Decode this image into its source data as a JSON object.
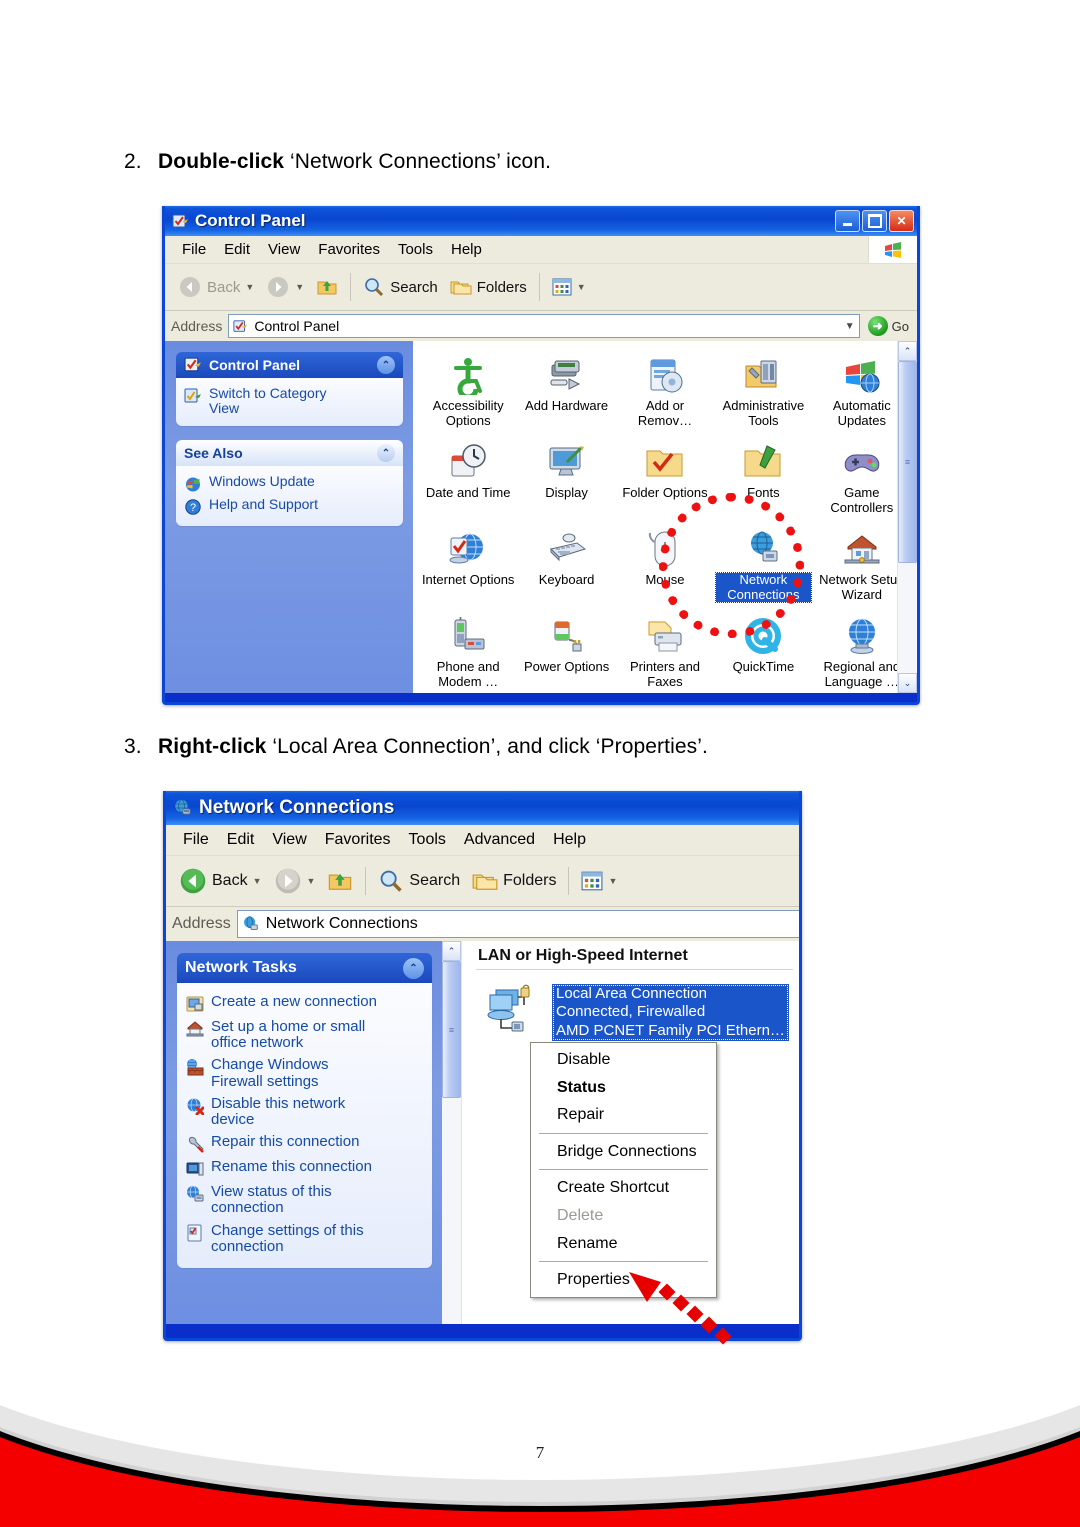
{
  "document": {
    "page_number": "7",
    "steps": [
      {
        "number": "2.",
        "text_plain": "Double-click ‘Network Connections’ icon.",
        "bold_part": "Double-click",
        "rest": " ‘Network Connections’ icon."
      },
      {
        "number": "3.",
        "text_plain": "Right-click ‘Local Area Connection’, and click ‘Properties’.",
        "bold_part": "Right-click",
        "rest": " ‘Local Area Connection’, and click ‘Properties’."
      }
    ]
  },
  "control_panel_window": {
    "title": "Control Panel",
    "title_icon": "control-panel-icon",
    "window_buttons": {
      "minimize": "_",
      "maximize": "□",
      "close": "✕"
    },
    "menu": [
      "File",
      "Edit",
      "View",
      "Favorites",
      "Tools",
      "Help"
    ],
    "toolbar": {
      "back_label": "Back",
      "forward_label": "",
      "up_label": "",
      "search_label": "Search",
      "folders_label": "Folders",
      "views_label": ""
    },
    "address": {
      "label": "Address",
      "value": "Control Panel",
      "go_label": "Go"
    },
    "sidebar": {
      "panels": [
        {
          "title": "Control Panel",
          "style": "blue",
          "icon": "control-panel-icon",
          "items": [
            {
              "label": "Switch to Category View",
              "icon": "category-view-icon"
            }
          ]
        },
        {
          "title": "See Also",
          "style": "pale",
          "icon": "",
          "items": [
            {
              "label": "Windows Update",
              "icon": "windows-update-icon"
            },
            {
              "label": "Help and Support",
              "icon": "help-support-icon"
            }
          ]
        }
      ]
    },
    "icons": [
      {
        "label": "Accessibility Options",
        "icon": "accessibility-icon",
        "selected": false
      },
      {
        "label": "Add Hardware",
        "icon": "add-hardware-icon",
        "selected": false
      },
      {
        "label": "Add or Remov…",
        "icon": "add-remove-programs-icon",
        "selected": false
      },
      {
        "label": "Administrative Tools",
        "icon": "administrative-tools-icon",
        "selected": false
      },
      {
        "label": "Automatic Updates",
        "icon": "automatic-updates-icon",
        "selected": false
      },
      {
        "label": "Date and Time",
        "icon": "date-time-icon",
        "selected": false
      },
      {
        "label": "Display",
        "icon": "display-icon",
        "selected": false
      },
      {
        "label": "Folder Options",
        "icon": "folder-options-icon",
        "selected": false
      },
      {
        "label": "Fonts",
        "icon": "fonts-icon",
        "selected": false
      },
      {
        "label": "Game Controllers",
        "icon": "game-controllers-icon",
        "selected": false
      },
      {
        "label": "Internet Options",
        "icon": "internet-options-icon",
        "selected": false
      },
      {
        "label": "Keyboard",
        "icon": "keyboard-icon",
        "selected": false
      },
      {
        "label": "Mouse",
        "icon": "mouse-icon",
        "selected": false
      },
      {
        "label": "Network Connections",
        "icon": "network-connections-icon",
        "selected": true
      },
      {
        "label": "Network Setup Wizard",
        "icon": "network-setup-wizard-icon",
        "selected": false
      },
      {
        "label": "Phone and Modem …",
        "icon": "phone-modem-icon",
        "selected": false
      },
      {
        "label": "Power Options",
        "icon": "power-options-icon",
        "selected": false
      },
      {
        "label": "Printers and Faxes",
        "icon": "printers-faxes-icon",
        "selected": false
      },
      {
        "label": "QuickTime",
        "icon": "quicktime-icon",
        "selected": false
      },
      {
        "label": "Regional and Language …",
        "icon": "regional-language-icon",
        "selected": false
      }
    ],
    "highlight": {
      "shape": "dotted-circle",
      "color": "#ee1111",
      "target": "Network Connections"
    }
  },
  "network_connections_window": {
    "title": "Network Connections",
    "title_icon": "network-connections-icon",
    "menu": [
      "File",
      "Edit",
      "View",
      "Favorites",
      "Tools",
      "Advanced",
      "Help"
    ],
    "toolbar": {
      "back_label": "Back",
      "search_label": "Search",
      "folders_label": "Folders"
    },
    "address": {
      "label": "Address",
      "value": "Network Connections"
    },
    "sidebar": {
      "panels": [
        {
          "title": "Network Tasks",
          "style": "blue",
          "items": [
            {
              "label": "Create a new connection",
              "icon": "new-connection-icon"
            },
            {
              "label": "Set up a home or small office network",
              "icon": "home-network-icon"
            },
            {
              "label": "Change Windows Firewall settings",
              "icon": "firewall-icon"
            },
            {
              "label": "Disable this network device",
              "icon": "disable-device-icon"
            },
            {
              "label": "Repair this connection",
              "icon": "repair-icon"
            },
            {
              "label": "Rename this connection",
              "icon": "rename-icon"
            },
            {
              "label": "View status of this connection",
              "icon": "view-status-icon"
            },
            {
              "label": "Change settings of this connection",
              "icon": "change-settings-icon"
            }
          ]
        }
      ]
    },
    "group_header": "LAN or High-Speed Internet",
    "connection": {
      "icon": "lan-connection-icon",
      "name": "Local Area Connection",
      "status": "Connected, Firewalled",
      "adapter": "AMD PCNET Family PCI Ethern…",
      "selected": true
    },
    "context_menu": {
      "items": [
        {
          "label": "Disable",
          "bold": false,
          "disabled": false,
          "separator_after": false
        },
        {
          "label": "Status",
          "bold": true,
          "disabled": false,
          "separator_after": false
        },
        {
          "label": "Repair",
          "bold": false,
          "disabled": false,
          "separator_after": true
        },
        {
          "label": "Bridge Connections",
          "bold": false,
          "disabled": false,
          "separator_after": true
        },
        {
          "label": "Create Shortcut",
          "bold": false,
          "disabled": false,
          "separator_after": false
        },
        {
          "label": "Delete",
          "bold": false,
          "disabled": true,
          "separator_after": false
        },
        {
          "label": "Rename",
          "bold": false,
          "disabled": false,
          "separator_after": true
        },
        {
          "label": "Properties",
          "bold": false,
          "disabled": false,
          "separator_after": false
        }
      ]
    },
    "callout": {
      "shape": "dashed-arrow",
      "color": "#e60000",
      "points_to": "Properties"
    }
  },
  "theme": {
    "accent_blue": "#0a46d8",
    "titlebar_blue": "#0c54d8",
    "sidebar_blue": "#7b96e0",
    "selection_blue": "#1a55c9",
    "toolbar_beige": "#edeade",
    "highlight_red": "#ee1111",
    "footer_red": "#f40000"
  }
}
